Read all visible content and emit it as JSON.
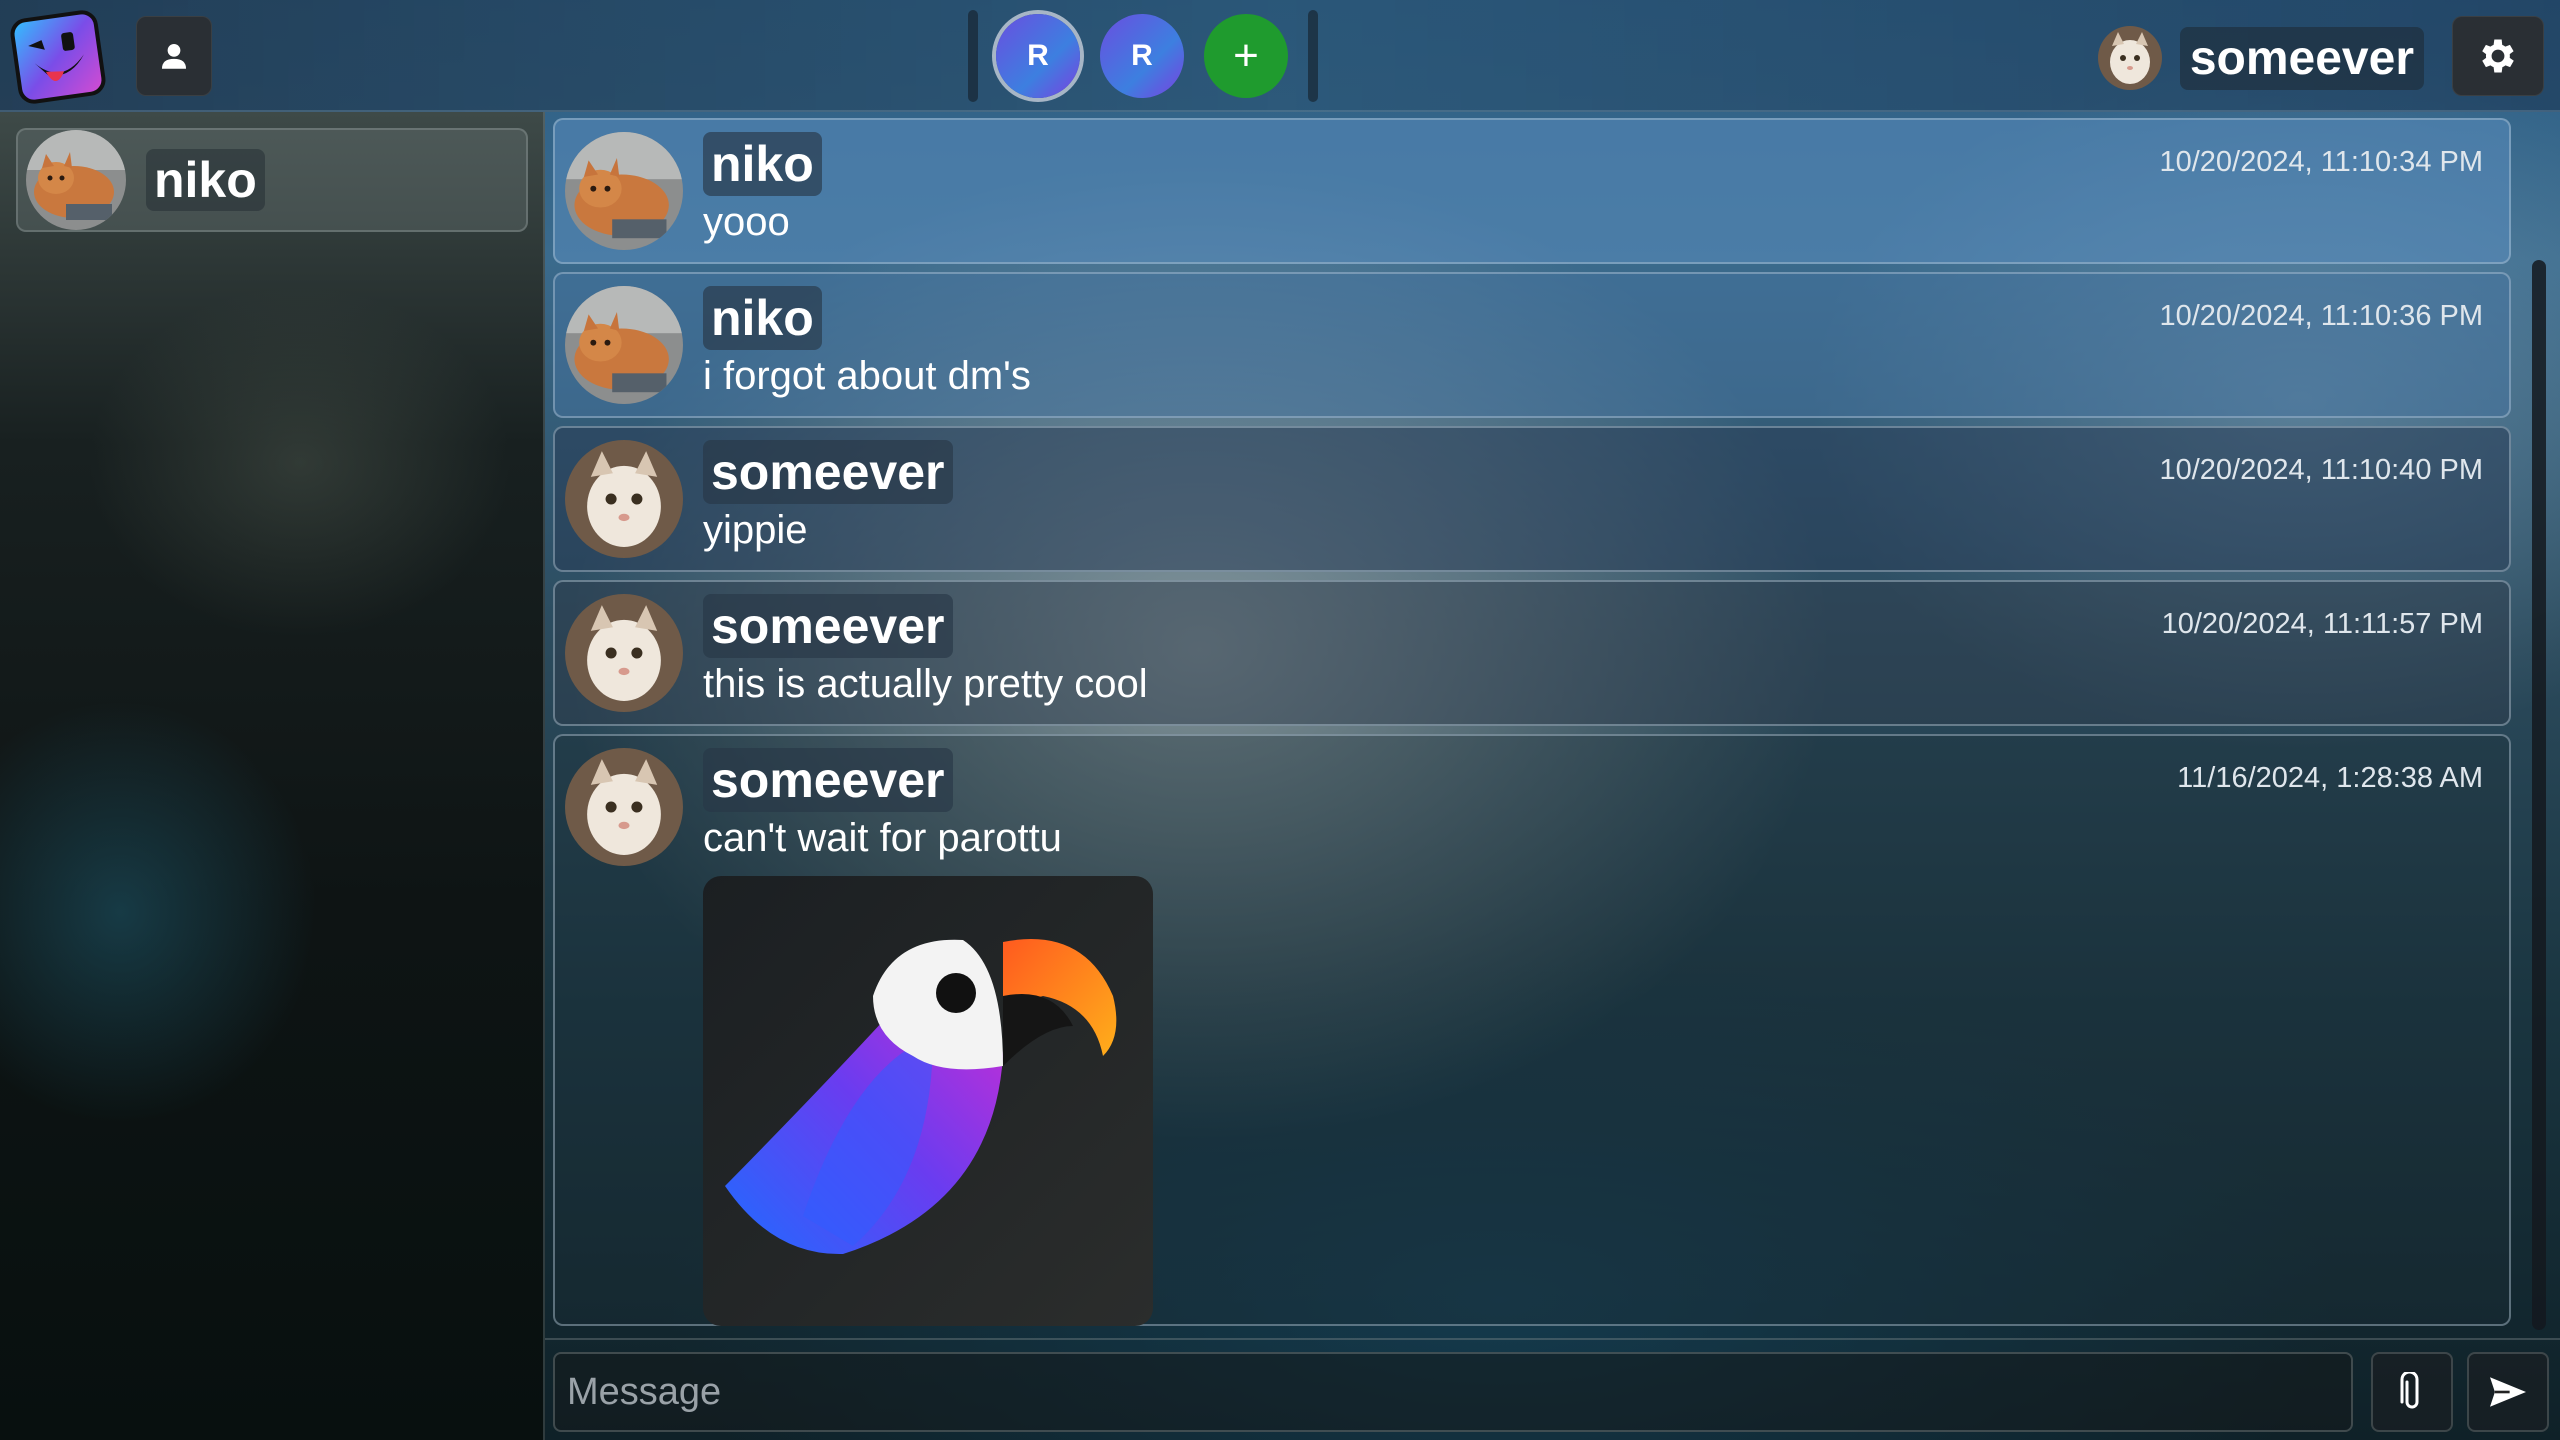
{
  "topbar": {
    "servers": [
      {
        "label": "R",
        "active": true
      },
      {
        "label": "R",
        "active": false
      }
    ],
    "add_server_label": "+",
    "current_user": "someever"
  },
  "sidebar": {
    "dms": [
      {
        "name": "niko"
      }
    ]
  },
  "messages": [
    {
      "author": "niko",
      "text": "yooo",
      "time": "10/20/2024, 11:10:34 PM",
      "avatar": "orange-cat"
    },
    {
      "author": "niko",
      "text": "i forgot about dm's",
      "time": "10/20/2024, 11:10:36 PM",
      "avatar": "orange-cat"
    },
    {
      "author": "someever",
      "text": "yippie",
      "time": "10/20/2024, 11:10:40 PM",
      "avatar": "white-cat"
    },
    {
      "author": "someever",
      "text": "this is actually pretty cool",
      "time": "10/20/2024, 11:11:57 PM",
      "avatar": "white-cat"
    },
    {
      "author": "someever",
      "text": "can't wait for parottu",
      "time": "11/16/2024, 1:28:38 AM",
      "avatar": "white-cat",
      "attachment": "parrot-image"
    }
  ],
  "composer": {
    "placeholder": "Message"
  },
  "colors": {
    "server_gradient": "#6a4ee0",
    "add_server": "#1f9b2e",
    "button_bg": "#2a2f34"
  }
}
